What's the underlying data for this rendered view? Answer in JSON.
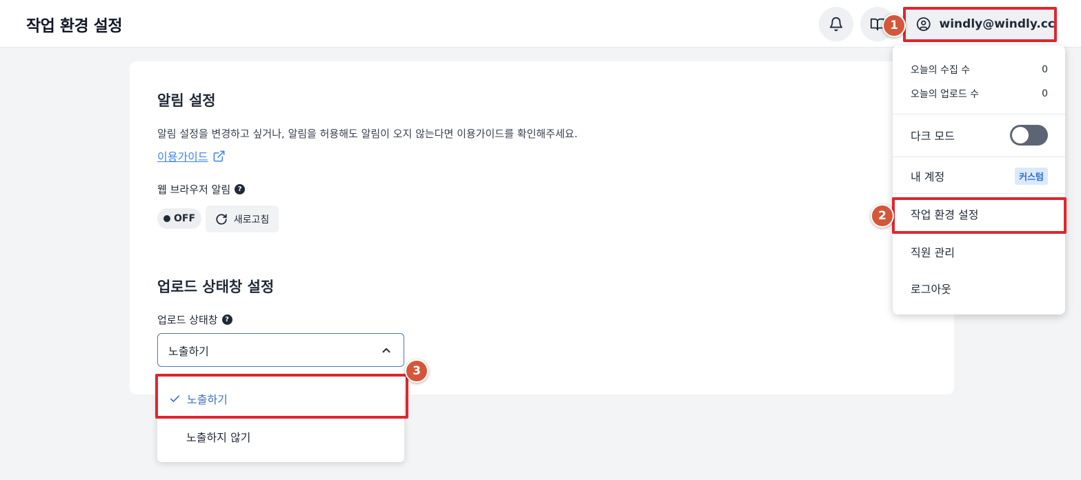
{
  "header": {
    "title": "작업 환경 설정",
    "account_email": "windly@windly.cc"
  },
  "notification": {
    "title": "알림 설정",
    "description": "알림 설정을 변경하고 싶거나, 알림을 허용해도 알림이 오지 않는다면 이용가이드를 확인해주세요.",
    "guide_link": "이용가이드",
    "browser_label": "웹 브라우저 알림",
    "toggle_state": "OFF",
    "refresh_label": "새로고침"
  },
  "upload": {
    "title": "업로드 상태창 설정",
    "field_label": "업로드 상태창",
    "selected": "노출하기",
    "options": [
      {
        "label": "노출하기",
        "selected": true
      },
      {
        "label": "노출하지 않기",
        "selected": false
      }
    ]
  },
  "menu": {
    "stats": [
      {
        "label": "오늘의 수집 수",
        "value": "0"
      },
      {
        "label": "오늘의 업로드 수",
        "value": "0"
      }
    ],
    "dark_mode_label": "다크 모드",
    "dark_mode_on": false,
    "account_label": "내 계정",
    "account_badge": "커스텀",
    "settings_label": "작업 환경 설정",
    "staff_label": "직원 관리",
    "logout_label": "로그아웃"
  },
  "steps": [
    "1",
    "2",
    "3"
  ],
  "colors": {
    "highlight": "#e0262e",
    "step_badge": "#d4573b",
    "link": "#3b82f6",
    "select_border": "#4a77b8",
    "toggle_off": "#5b6574"
  },
  "icons": [
    "bell-icon",
    "book-icon",
    "user-circle-icon",
    "external-link-icon",
    "help-icon",
    "refresh-icon",
    "chevron-up-icon",
    "check-icon"
  ]
}
